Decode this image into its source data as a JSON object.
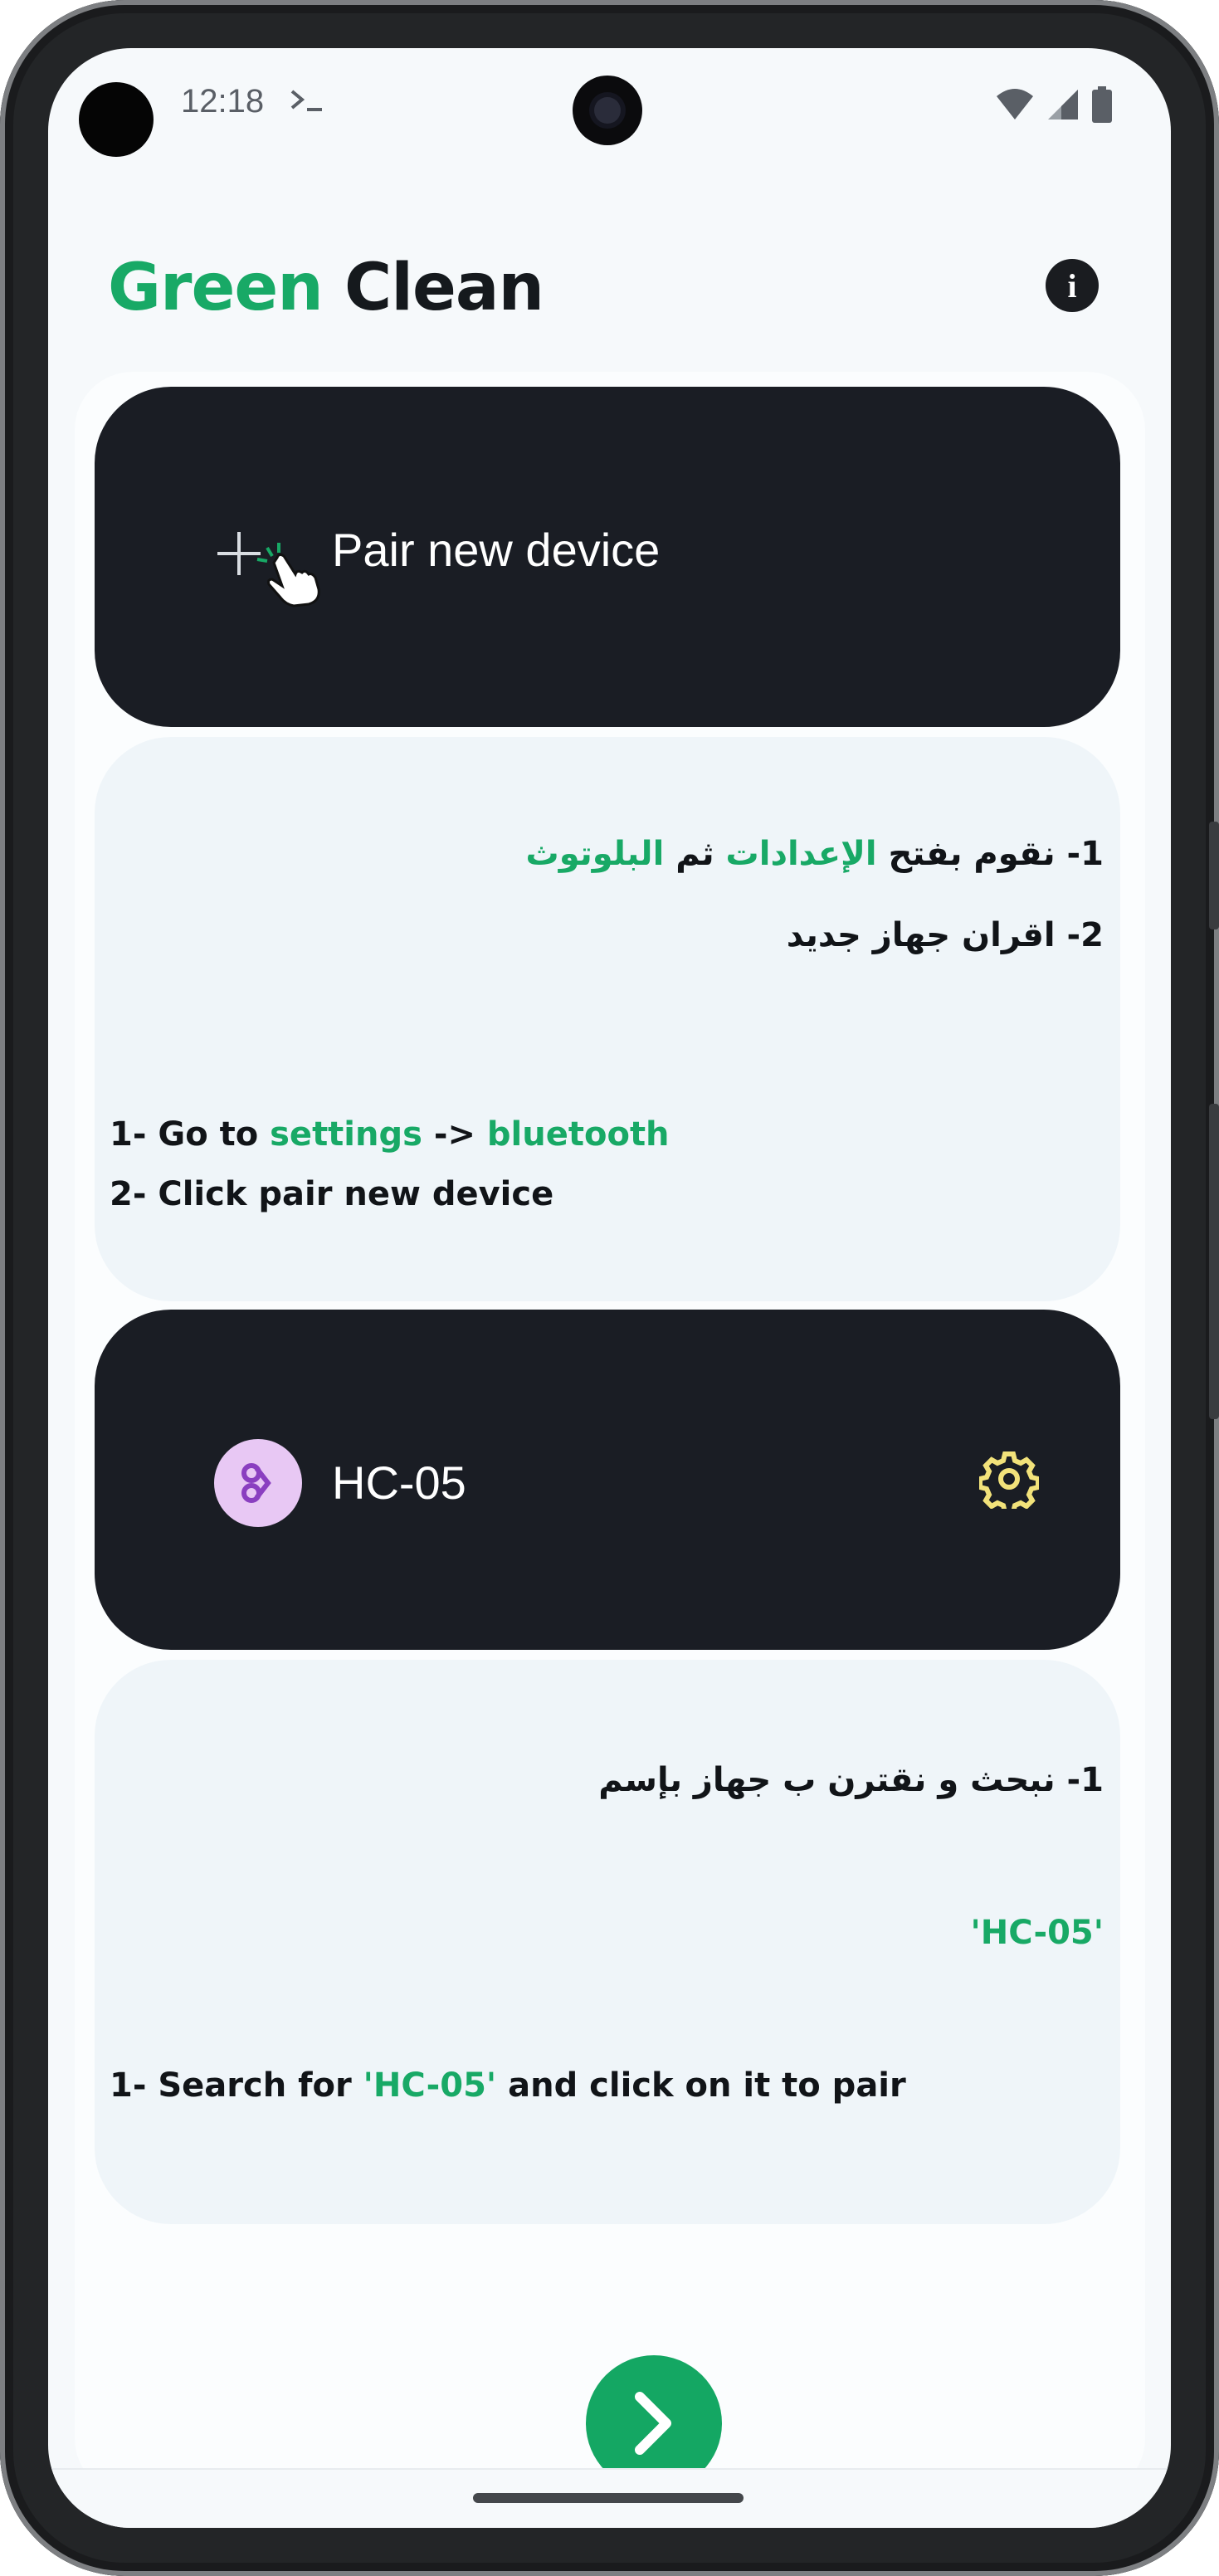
{
  "status_bar": {
    "time": "12:18",
    "icons": [
      "terminal-icon",
      "wifi-icon",
      "signal-icon",
      "battery-icon"
    ]
  },
  "header": {
    "title_part1": "Green",
    "title_part2": " Clean",
    "info_button_icon": "info-icon",
    "info_glyph": "i"
  },
  "pair_card": {
    "label": "Pair new device",
    "icons": [
      "plus-icon",
      "hand-pointer-icon"
    ]
  },
  "step1_card": {
    "ar_line1_prefix": "1- نقوم بفتح ",
    "ar_line1_settings": "الإعدادات",
    "ar_line1_mid": " ثم ",
    "ar_line1_bluetooth": "البلوتوث",
    "ar_line2": "2- اقران جهاز جديد",
    "en_line1_prefix": "1- Go to ",
    "en_line1_settings": "settings",
    "en_line1_arrow": " -> ",
    "en_line1_bluetooth": "bluetooth",
    "en_line2": "2- Click pair new device"
  },
  "device_card": {
    "device_name": "HC-05",
    "icons": [
      "bluetooth-device-icon",
      "gear-icon"
    ]
  },
  "step2_card": {
    "ar_line1": "1- نبحث و نقترن ب جهاز بإسم",
    "ar_device_name": "'HC-05'",
    "en_prefix": "1- Search for ",
    "en_device_name": "'HC-05'",
    "en_suffix": " and click on it to pair"
  },
  "next_button": {
    "icon": "chevron-right-icon"
  },
  "colors": {
    "accent": "#18a966",
    "dark_card": "#1a1d24",
    "light_card": "#eff5f9",
    "avatar": "#e8c8f4",
    "gear": "#f2e27a"
  }
}
